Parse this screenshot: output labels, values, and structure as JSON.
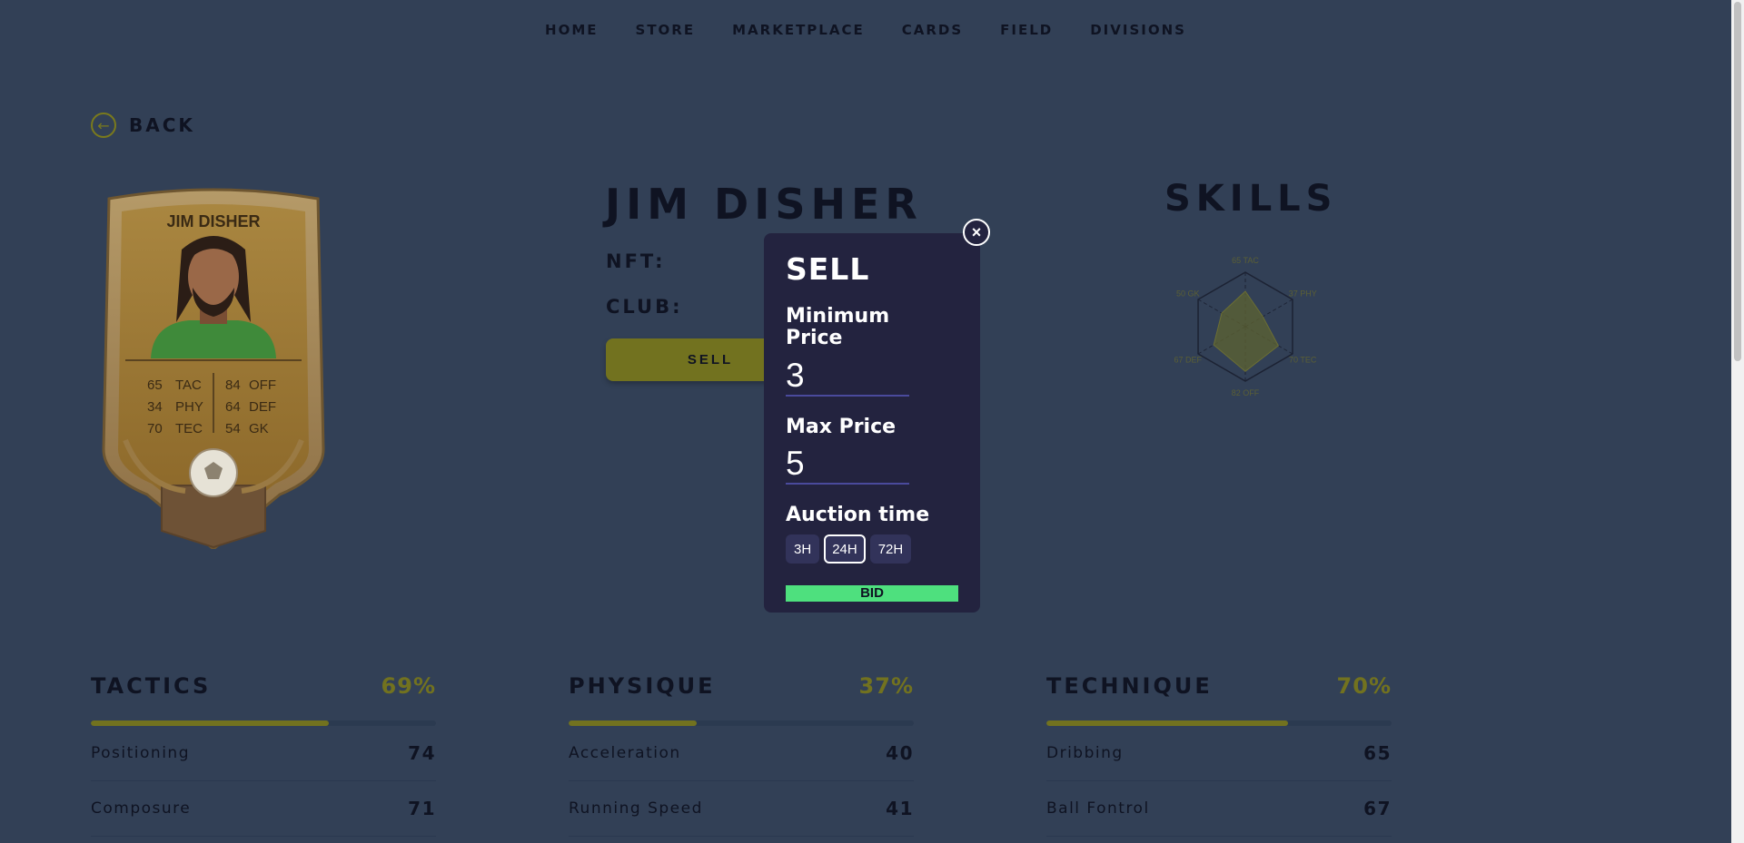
{
  "nav": {
    "items": [
      "HOME",
      "STORE",
      "MARKETPLACE",
      "CARDS",
      "FIELD",
      "DIVISIONS"
    ]
  },
  "back": {
    "label": "BACK"
  },
  "player": {
    "name": "JIM DISHER",
    "nft_label": "NFT:",
    "club_label": "CLUB:",
    "sell_label": "SELL",
    "card_name": "JIM DISHER",
    "card_stats_left": [
      [
        "65",
        "TAC"
      ],
      [
        "34",
        "PHY"
      ],
      [
        "70",
        "TEC"
      ]
    ],
    "card_stats_right": [
      [
        "84",
        "OFF"
      ],
      [
        "64",
        "DEF"
      ],
      [
        "54",
        "GK"
      ]
    ]
  },
  "skills": {
    "title": "SKILLS",
    "radar_labels": [
      "65 TAC",
      "37 PHY",
      "70 TEC",
      "82 OFF",
      "67 DEF",
      "50 GK"
    ],
    "radar_values": [
      65,
      37,
      70,
      82,
      67,
      50
    ]
  },
  "categories": [
    {
      "title": "TACTICS",
      "pct": "69%",
      "fill": 0.69,
      "rows": [
        {
          "label": "Positioning",
          "value": "74"
        },
        {
          "label": "Composure",
          "value": "71"
        }
      ]
    },
    {
      "title": "PHYSIQUE",
      "pct": "37%",
      "fill": 0.37,
      "rows": [
        {
          "label": "Acceleration",
          "value": "40"
        },
        {
          "label": "Running Speed",
          "value": "41"
        }
      ]
    },
    {
      "title": "TECHNIQUE",
      "pct": "70%",
      "fill": 0.7,
      "rows": [
        {
          "label": "Dribbing",
          "value": "65"
        },
        {
          "label": "Ball Fontrol",
          "value": "67"
        }
      ]
    }
  ],
  "modal": {
    "title": "SELL",
    "min_label": "Minimum Price",
    "min_value": "3",
    "max_label": "Max Price",
    "max_value": "5",
    "auction_label": "Auction time",
    "options": [
      "3H",
      "24H",
      "72H"
    ],
    "selected": "24H",
    "bid_label": "BID",
    "close_glyph": "×"
  },
  "colors": {
    "background": "#324056",
    "accent": "#72721f",
    "modal": "#23233f",
    "bid": "#4ee07e"
  }
}
